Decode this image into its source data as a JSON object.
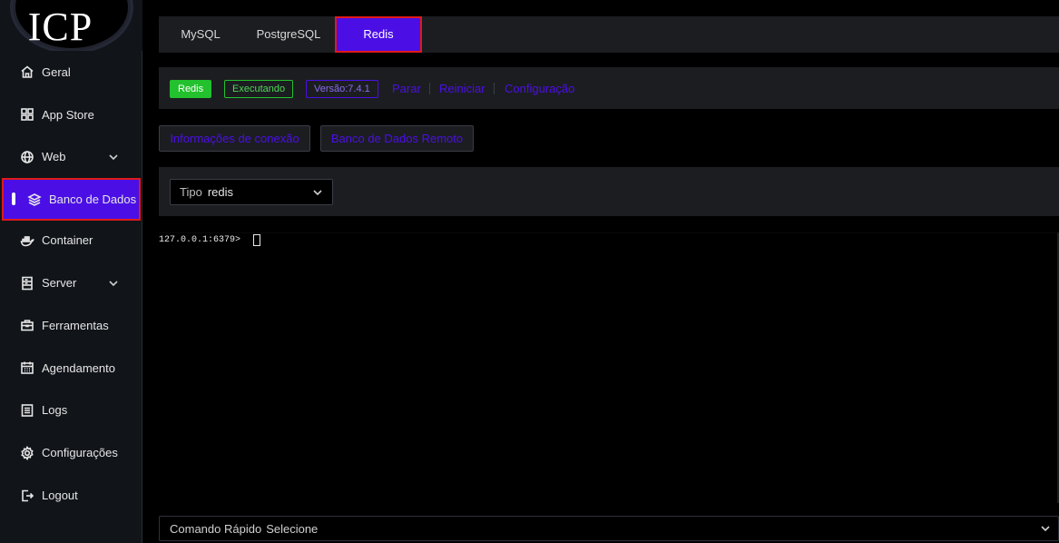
{
  "logo": {
    "text": "ICP"
  },
  "sidebar": {
    "items": [
      {
        "label": "Geral",
        "icon": "home-icon"
      },
      {
        "label": "App Store",
        "icon": "grid-icon"
      },
      {
        "label": "Web",
        "icon": "globe-icon",
        "expandable": true
      },
      {
        "label": "Banco de Dados",
        "icon": "layers-icon",
        "active": true
      },
      {
        "label": "Container",
        "icon": "docker-icon"
      },
      {
        "label": "Server",
        "icon": "server-icon",
        "expandable": true
      },
      {
        "label": "Ferramentas",
        "icon": "toolbox-icon"
      },
      {
        "label": "Agendamento",
        "icon": "calendar-icon"
      },
      {
        "label": "Logs",
        "icon": "list-icon"
      },
      {
        "label": "Configurações",
        "icon": "gear-icon"
      },
      {
        "label": "Logout",
        "icon": "logout-icon"
      }
    ]
  },
  "tabs": [
    {
      "label": "MySQL"
    },
    {
      "label": "PostgreSQL"
    },
    {
      "label": "Redis",
      "active": true
    }
  ],
  "status": {
    "app_name": "Redis",
    "state": "Executando",
    "version": "Versão:7.4.1",
    "actions": [
      "Parar",
      "Reiniciar",
      "Configuração"
    ]
  },
  "buttons": {
    "connection_info": "Informações de conexão",
    "remote_db": "Banco de Dados Remoto"
  },
  "type_select": {
    "label": "Tipo",
    "value": "redis"
  },
  "terminal": {
    "prompt": "127.0.0.1:6379>"
  },
  "quick_command": {
    "label": "Comando Rápido",
    "value": "Selecione"
  },
  "colors": {
    "accent": "#4b0fe6",
    "running": "#22c12d",
    "highlight_border": "#e01a1a",
    "panel": "#1c1d21"
  }
}
